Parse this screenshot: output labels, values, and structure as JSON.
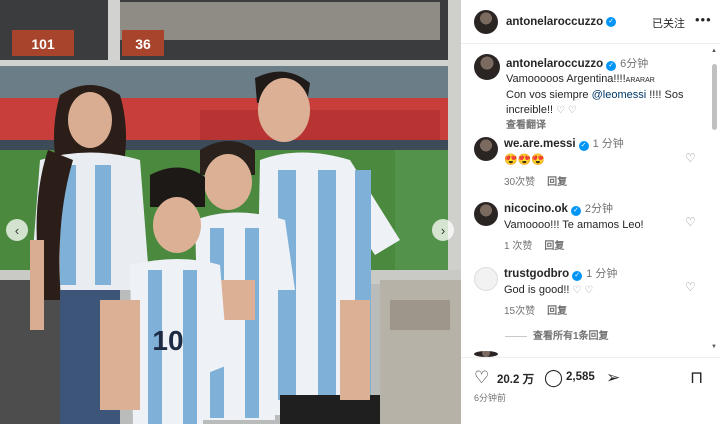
{
  "post": {
    "author": "antonelaroccuzzo",
    "follow_status": "已关注",
    "more_icon": "more-horizontal-icon",
    "verified_icon": "verified-badge-icon"
  },
  "caption": {
    "username": "antonelaroccuzzo",
    "time": "6分钟",
    "line1": "Vamooooos Argentina!!!!",
    "line1_tag": "ARARAR",
    "line2_pre": "Con vos siempre ",
    "mention": "@leomessi",
    "line2_post": " !!!! Sos",
    "line3": "increible!! ",
    "line3_hearts": "♡ ♡",
    "see_translation": "查看翻译"
  },
  "comments": [
    {
      "username": "we.are.messi",
      "verified": true,
      "time": "1 分钟",
      "text": "😍😍😍",
      "likes": "30次赞",
      "reply": "回复"
    },
    {
      "username": "nicocino.ok",
      "verified": true,
      "time": "2分钟",
      "text": "Vamoooo!!! Te amamos Leo!",
      "likes": "1 次赞",
      "reply": "回复"
    },
    {
      "username": "trustgodbro",
      "verified": true,
      "time": "1 分钟",
      "text": "God is good!!",
      "text_hearts": "♡ ♡",
      "likes": "15次赞",
      "reply": "回复"
    }
  ],
  "view_replies": "查看所有1条回复",
  "actions": {
    "likes_count": "20.2 万",
    "comments_count": "2,585",
    "posted_time": "6分钟前",
    "icons": [
      "heart-icon",
      "comment-icon",
      "share-icon",
      "bookmark-icon"
    ]
  },
  "photo": {
    "stadium_sign_left": "101",
    "stadium_sign_right": "36",
    "jersey_number": "10"
  },
  "colors": {
    "accent": "#0095f6",
    "mention": "#00376b",
    "meta": "#737373"
  }
}
